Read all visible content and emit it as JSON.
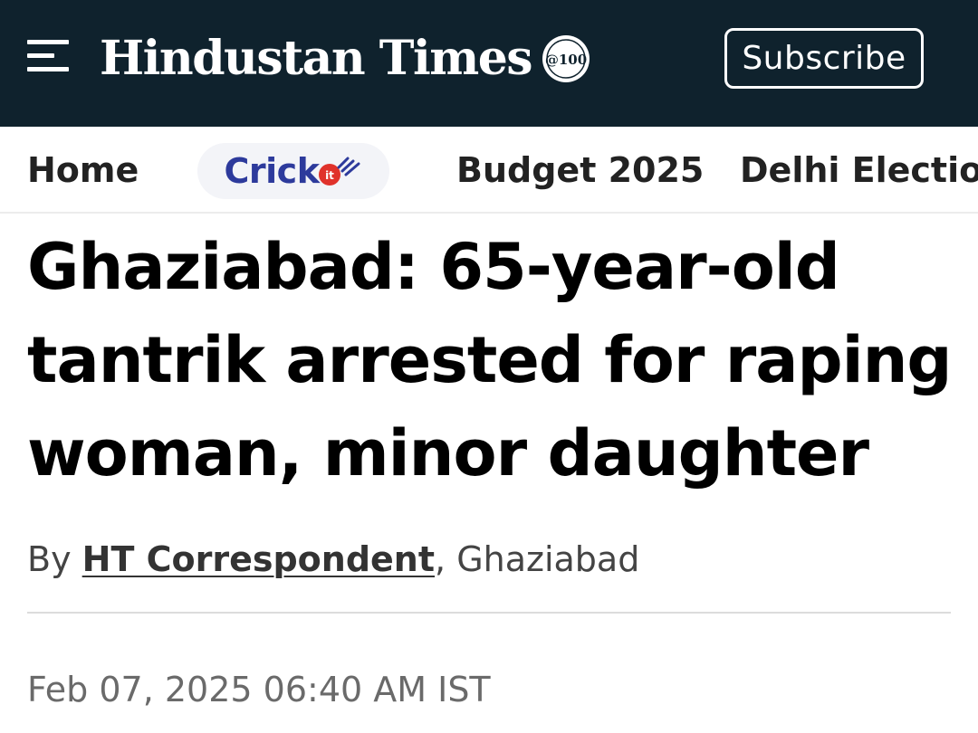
{
  "header": {
    "menu_icon": "hamburger-menu-icon",
    "logo_text": "Hindustan Times",
    "seal_icon": "centenary-seal-icon",
    "seal_text": "@100",
    "subscribe_label": "Subscribe",
    "background_color": "#0f222d"
  },
  "nav": {
    "items": [
      {
        "label": "Home"
      },
      {
        "label": "Crick",
        "icon": "cricket-ball-icon"
      },
      {
        "label": "Budget 2025"
      },
      {
        "label": "Delhi Election"
      }
    ]
  },
  "article": {
    "headline": "Ghaziabad: 65-year-old tantrik arrested for raping woman, minor daughter",
    "byline_prefix": "By",
    "author": "HT Correspondent",
    "byline_suffix": ", Ghaziabad",
    "datetime": "Feb 07, 2025 06:40 AM IST"
  },
  "colors": {
    "header_bg": "#0f222d",
    "crick_text": "#2d3a9c",
    "crick_ball": "#e0322b"
  }
}
